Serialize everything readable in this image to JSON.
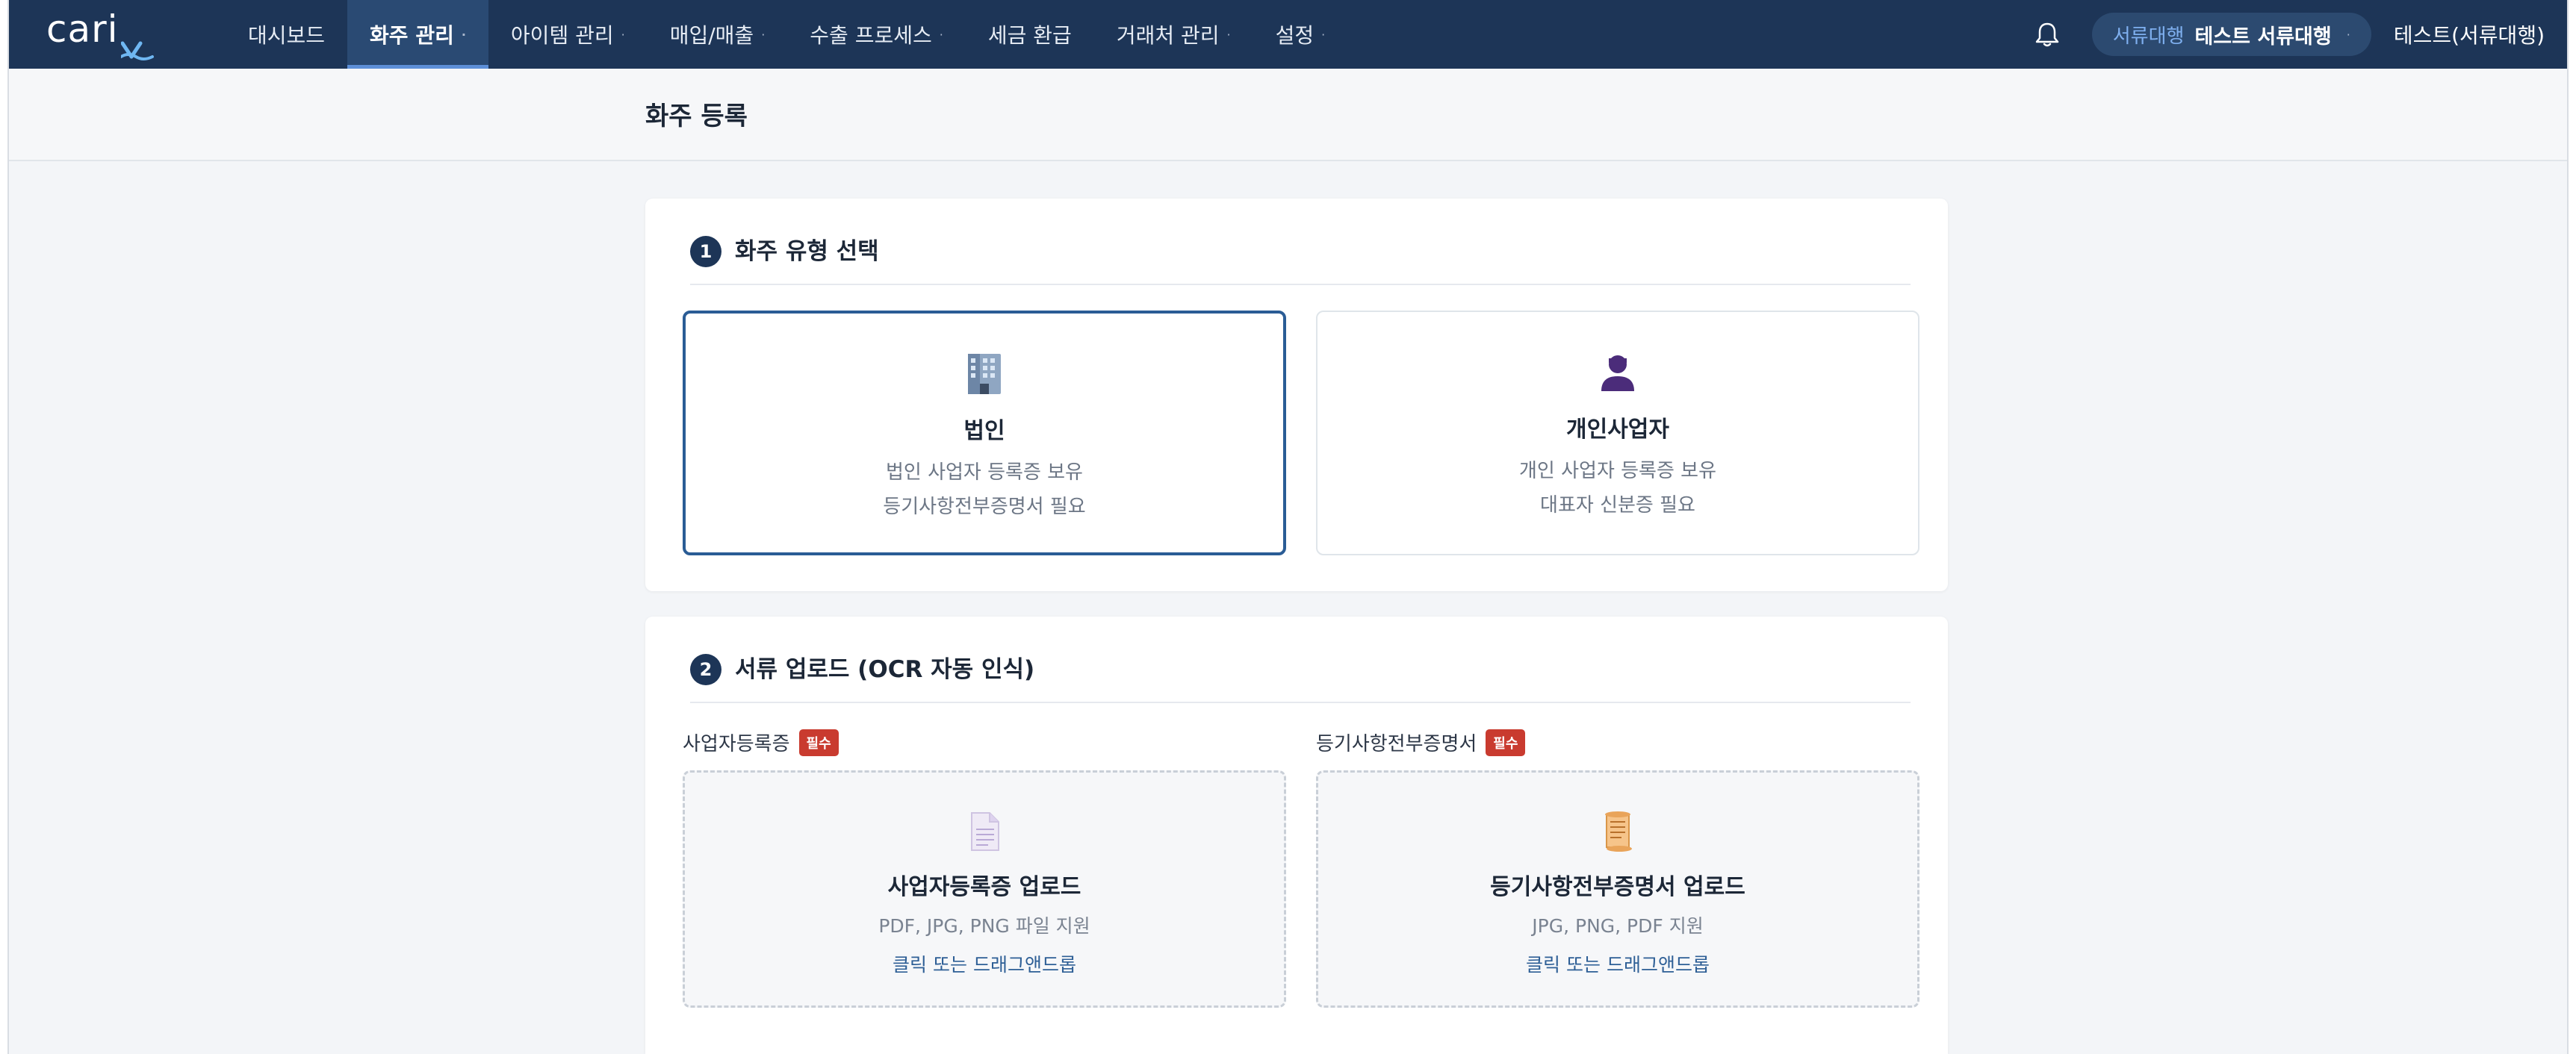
{
  "nav": {
    "logo": "cari",
    "items": [
      {
        "label": "대시보드",
        "caret": ""
      },
      {
        "label": "화주 관리",
        "caret": "·"
      },
      {
        "label": "아이템 관리",
        "caret": "·"
      },
      {
        "label": "매입/매출",
        "caret": "·"
      },
      {
        "label": "수출 프로세스",
        "caret": "·"
      },
      {
        "label": "세금 환급",
        "caret": ""
      },
      {
        "label": "거래처 관리",
        "caret": "·"
      },
      {
        "label": "설정",
        "caret": "·"
      }
    ],
    "active_index": 1,
    "user_role": "서류대행",
    "user_name": "테스트 서류대행",
    "pill_caret": "·",
    "account_label": "테스트(서류대행)"
  },
  "page": {
    "title": "화주 등록"
  },
  "step1": {
    "number": "1",
    "title": "화주 유형 선택",
    "options": [
      {
        "title": "법인",
        "desc1": "법인 사업자 등록증 보유",
        "desc2": "등기사항전부증명서 필요",
        "icon": "office-building-icon",
        "selected": true
      },
      {
        "title": "개인사업자",
        "desc1": "개인 사업자 등록증 보유",
        "desc2": "대표자 신분증 필요",
        "icon": "person-icon",
        "selected": false
      }
    ]
  },
  "step2": {
    "number": "2",
    "title": "서류 업로드 (OCR 자동 인식)",
    "uploads": [
      {
        "label": "사업자등록증",
        "badge": "필수",
        "title": "사업자등록증 업로드",
        "formats": "PDF, JPG, PNG 파일 지원",
        "action": "클릭 또는 드래그앤드롭",
        "icon": "document-icon"
      },
      {
        "label": "등기사항전부증명서",
        "badge": "필수",
        "title": "등기사항전부증명서 업로드",
        "formats": "JPG, PNG, PDF 지원",
        "action": "클릭 또는 드래그앤드롭",
        "icon": "scroll-icon"
      }
    ]
  },
  "colors": {
    "nav_bg": "#1d3557",
    "accent": "#2a5c95",
    "badge": "#c93b2f",
    "link": "#2e5f96"
  }
}
